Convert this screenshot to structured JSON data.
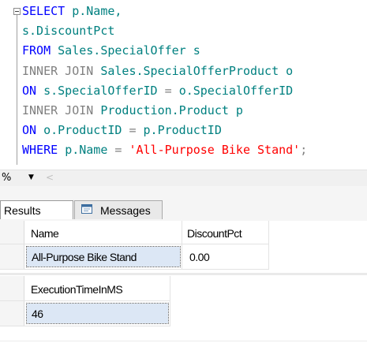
{
  "editor": {
    "lines": [
      {
        "parts": [
          {
            "t": "SELECT ",
            "c": "kw"
          },
          {
            "t": "p.Name,",
            "c": "tx"
          }
        ]
      },
      {
        "parts": [
          {
            "t": "s.DiscountPct",
            "c": "tx"
          }
        ]
      },
      {
        "parts": [
          {
            "t": "FROM ",
            "c": "kw"
          },
          {
            "t": "Sales.SpecialOffer s",
            "c": "tx"
          }
        ]
      },
      {
        "parts": [
          {
            "t": "INNER JOIN ",
            "c": "gray"
          },
          {
            "t": "Sales.SpecialOfferProduct o",
            "c": "tx"
          }
        ]
      },
      {
        "parts": [
          {
            "t": "ON ",
            "c": "kw"
          },
          {
            "t": "s.SpecialOfferID ",
            "c": "tx"
          },
          {
            "t": "= ",
            "c": "op"
          },
          {
            "t": "o.SpecialOfferID",
            "c": "tx"
          }
        ]
      },
      {
        "parts": [
          {
            "t": "INNER JOIN ",
            "c": "gray"
          },
          {
            "t": "Production.Product p",
            "c": "tx"
          }
        ]
      },
      {
        "parts": [
          {
            "t": "ON ",
            "c": "kw"
          },
          {
            "t": "o.ProductID ",
            "c": "tx"
          },
          {
            "t": "= ",
            "c": "op"
          },
          {
            "t": "p.ProductID",
            "c": "tx"
          }
        ]
      },
      {
        "parts": [
          {
            "t": "WHERE ",
            "c": "kw"
          },
          {
            "t": "p.Name ",
            "c": "tx"
          },
          {
            "t": "= ",
            "c": "op"
          },
          {
            "t": "'All-Purpose Bike Stand'",
            "c": "str"
          },
          {
            "t": ";",
            "c": "op"
          }
        ]
      }
    ]
  },
  "zoom": {
    "label": "%",
    "arrow": "▼",
    "scroll": "<"
  },
  "tabs": {
    "results": "Results",
    "messages": "Messages"
  },
  "grid1": {
    "headers": [
      "Name",
      "DiscountPct"
    ],
    "row": [
      "All-Purpose Bike Stand",
      "0.00"
    ]
  },
  "grid2": {
    "headers": [
      "ExecutionTimeInMS"
    ],
    "row": [
      "46"
    ]
  },
  "icons": {
    "collapse": "collapse-minus-icon",
    "messages": "messages-icon"
  },
  "colors": {
    "keyword": "#0000ff",
    "identifier": "#008080",
    "string": "#ff0000",
    "join": "#808080"
  }
}
